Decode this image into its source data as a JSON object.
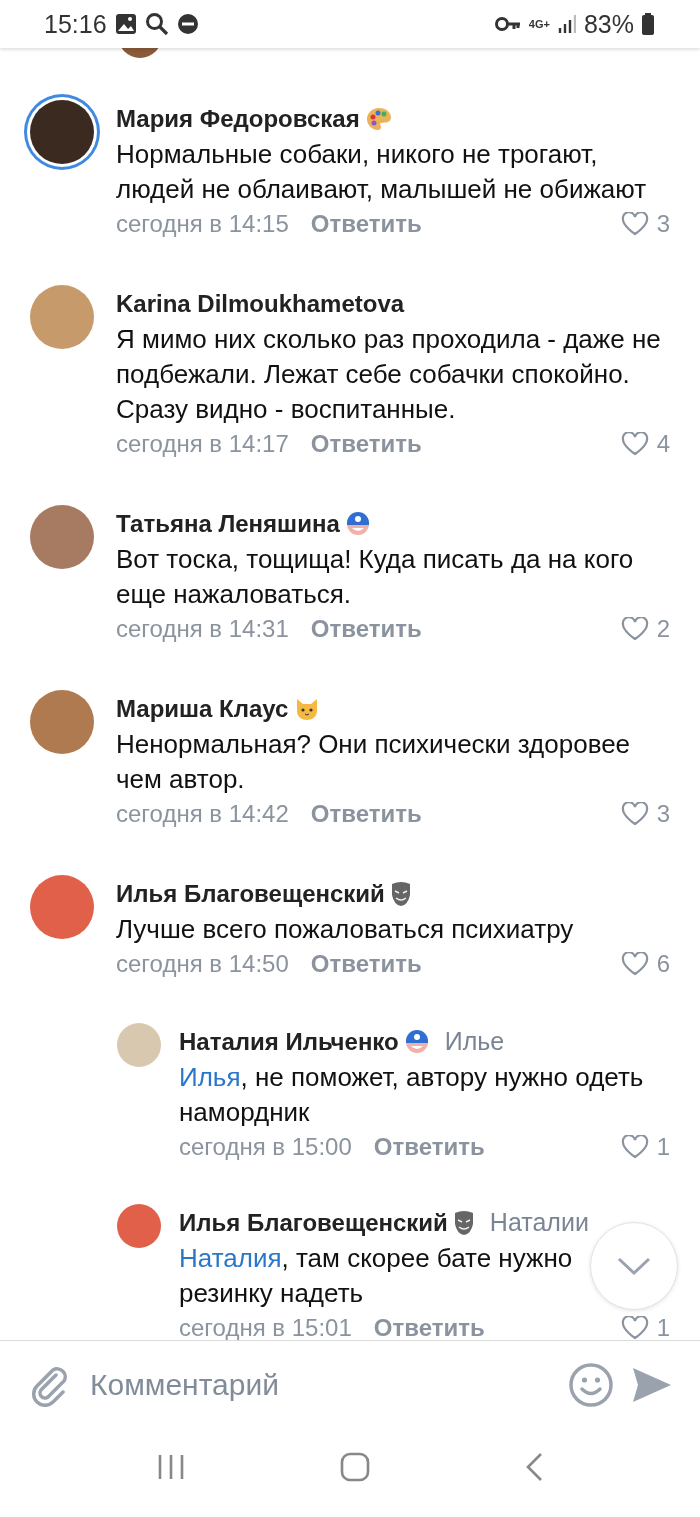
{
  "status_bar": {
    "time": "15:16",
    "network": "4G+",
    "battery": "83%"
  },
  "comments": [
    {
      "author": "Мария Федоровская",
      "badge": {
        "kind": "palette"
      },
      "has_story": true,
      "text": "Нормальные собаки, никого не трогают, людей не облаивают, малышей не обижают",
      "time": "сегодня в 14:15",
      "reply_label": "Ответить",
      "likes": "3"
    },
    {
      "author": "Karina Dilmoukhametova",
      "has_story": false,
      "text": "Я мимо них сколько раз проходила - даже не подбежали. Лежат себе собачки спокойно. Сразу видно - воспитанные.",
      "time": "сегодня в 14:17",
      "reply_label": "Ответить",
      "likes": "4"
    },
    {
      "author": "Татьяна Леняшина",
      "badge": {
        "kind": "hero"
      },
      "has_story": false,
      "text": "Вот тоска, тощища! Куда писать да на кого еще нажаловаться.",
      "time": "сегодня в 14:31",
      "reply_label": "Ответить",
      "likes": "2"
    },
    {
      "author": "Мариша Клаус",
      "badge": {
        "kind": "cat"
      },
      "has_story": false,
      "text": "Ненормальная? Они психически здоровее чем автор.",
      "time": "сегодня в 14:42",
      "reply_label": "Ответить",
      "likes": "3"
    },
    {
      "author": "Илья Благовещенский",
      "badge": {
        "kind": "mask"
      },
      "has_story": false,
      "text": "Лучше всего пожаловаться психиатру",
      "time": "сегодня в 14:50",
      "reply_label": "Ответить",
      "likes": "6",
      "replies": [
        {
          "author": "Наталия Ильченко",
          "badge": {
            "kind": "hero"
          },
          "reply_to": "Илье",
          "mention": "Илья",
          "text": ", не поможет, автору нужно одеть намордник",
          "time": "сегодня в 15:00",
          "reply_label": "Ответить",
          "likes": "1"
        },
        {
          "author": "Илья Благовещенский",
          "badge": {
            "kind": "mask"
          },
          "reply_to": "Наталии",
          "mention": "Наталия",
          "text": ", там скорее бате нужно резинку надеть",
          "time": "сегодня в 15:01",
          "reply_label": "Ответить",
          "likes": "1"
        }
      ]
    }
  ],
  "composer": {
    "placeholder": "Комментарий"
  }
}
